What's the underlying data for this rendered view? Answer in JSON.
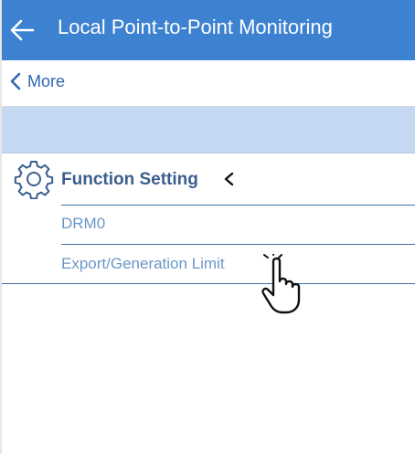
{
  "app_bar": {
    "title": "Local Point-to-Point Monitoring",
    "back_icon": "left-arrow-icon",
    "color": "#3d82d0"
  },
  "subnav": {
    "more_label": "More",
    "chevron_icon": "chevron-left-icon"
  },
  "section": {
    "title": "Function Setting",
    "icon": "gear-icon",
    "collapse_icon": "chevron-left-icon",
    "items": [
      {
        "label": "DRM0"
      },
      {
        "label": "Export/Generation Limit"
      }
    ]
  },
  "colors": {
    "accent": "#3d82d0",
    "banner": "#c5d8f2",
    "link": "#2f68b0",
    "item_text": "#6a96c8"
  }
}
